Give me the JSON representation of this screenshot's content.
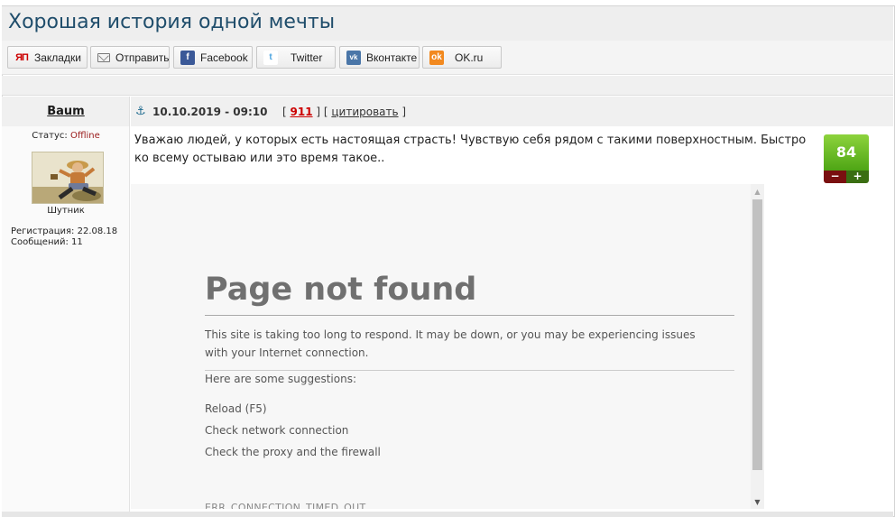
{
  "page": {
    "title": "Хорошая история одной мечты"
  },
  "share": {
    "buttons": [
      {
        "label": "Закладки",
        "icon": "yap-bookmarks-icon",
        "glyph": "ЯП"
      },
      {
        "label": "Отправить",
        "icon": "mail-icon",
        "glyph": ""
      },
      {
        "label": "Facebook",
        "icon": "facebook-icon",
        "glyph": "f"
      },
      {
        "label": "Twitter",
        "icon": "twitter-icon",
        "glyph": "t"
      },
      {
        "label": "Вконтакте",
        "icon": "vkontakte-icon",
        "glyph": "vk"
      },
      {
        "label": "OK.ru",
        "icon": "odnoklassniki-icon",
        "glyph": "ok"
      }
    ]
  },
  "user": {
    "name": "Baum",
    "status_label": "Статус:",
    "status_value": "Offline",
    "rank": "Шутник",
    "registration": "Регистрация: 22.08.18",
    "messages": "Сообщений: 11"
  },
  "post": {
    "anchor_icon": "anchor-icon",
    "datetime": "10.10.2019 - 09:10",
    "number": "911",
    "quote_label": "цитировать",
    "text": "Уважаю людей, у которых есть настоящая страсть! Чувствую себя рядом с такими поверхностным. Быстро ко всему остываю или это время такое..",
    "rating": {
      "score": "84",
      "minus": "−",
      "plus": "+"
    }
  },
  "embed": {
    "heading": "Page not found",
    "description": "This site is taking too long to respond. It may be down, or you may be experiencing issues with your Internet connection.",
    "suggestions_label": "Here are some suggestions:",
    "suggestions": [
      "Reload (F5)",
      "Check network connection",
      "Check the proxy and the firewall"
    ],
    "error_code": "ERR_CONNECTION_TIMED_OUT"
  },
  "colors": {
    "title": "#1f4d6b",
    "offline": "#9a1a1a",
    "post_number": "#cc0000",
    "rating_green": "#5fb31f",
    "rating_minus": "#7a1010",
    "rating_plus": "#3a6e12"
  }
}
